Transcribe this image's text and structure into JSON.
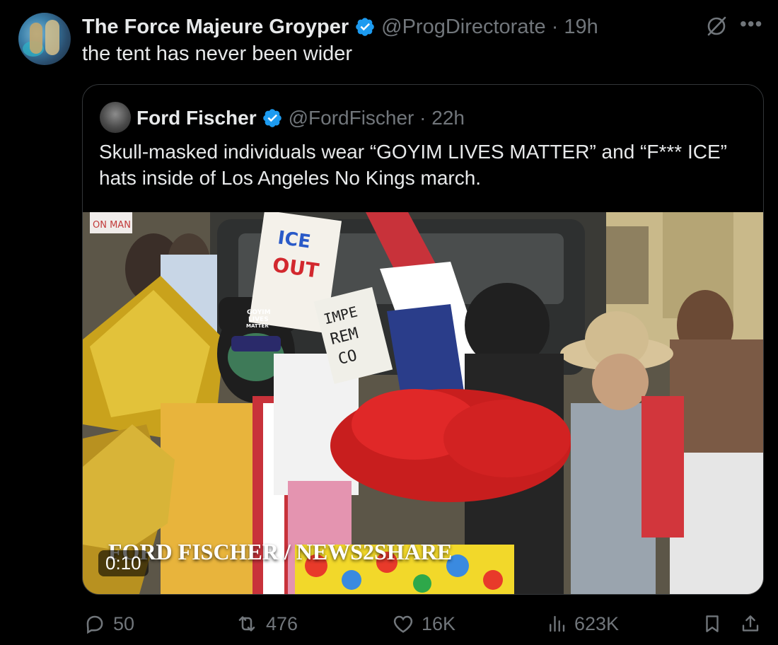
{
  "author": {
    "name": "The Force Majeure Groyper",
    "handle_time": "@ProgDirectorate · 19h",
    "verified": true,
    "avatar_icon": "profile-avatar-icon"
  },
  "tweet": {
    "text": "the tent has never been wider"
  },
  "quoted": {
    "name": "Ford Fischer",
    "handle_time": "@FordFischer · 22h",
    "verified": true,
    "text": "Skull-masked individuals wear “GOYIM LIVES MATTER” and “F*** ICE” hats inside of Los Angeles No Kings march.",
    "video": {
      "watermark": "FORD FISCHER / NEWS2SHARE",
      "duration": "0:10",
      "sign_ice": "ICE OUT",
      "sign_impeach": "IMPE REM CO",
      "hat_text": "GOYIM LIVES MATTER"
    }
  },
  "actions": {
    "replies": "50",
    "reposts": "476",
    "likes": "16K",
    "views": "623K"
  },
  "colors": {
    "background": "#000000",
    "text": "#e7e9ea",
    "secondary": "#71767b",
    "verified": "#1d9bf0",
    "border": "#333639"
  }
}
